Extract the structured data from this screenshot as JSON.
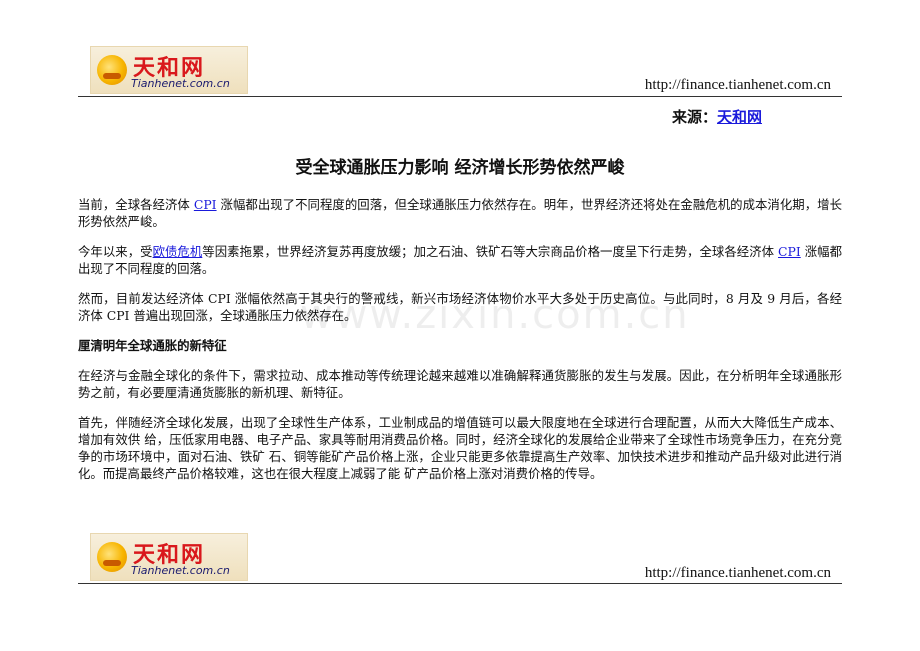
{
  "header": {
    "logo": {
      "cn": "天和网",
      "en": "Tianhenet.com.cn"
    },
    "url": "http://finance.tianhenet.com.cn"
  },
  "source": {
    "label": "来源：",
    "link": "天和网"
  },
  "title": "受全球通胀压力影响 经济增长形势依然严峻",
  "paragraphs": {
    "p1": {
      "a": "当前，全球各经济体 ",
      "cpi": "CPI",
      "b": " 涨幅都出现了不同程度的回落，但全球通胀压力依然存在。明年，世界经济还将处在金融危机的成本消化期，增长形势依然严峻。"
    },
    "p2": {
      "a": "今年以来，受",
      "link": "欧债危机",
      "b": "等因素拖累，世界经济复苏再度放缓；加之石油、铁矿石等大宗商品价格一度呈下行走势，全球各经济体 ",
      "cpi": "CPI",
      "c": " 涨幅都出现了不同程度的回落。"
    },
    "p3": "然而，目前发达经济体 CPI 涨幅依然高于其央行的警戒线，新兴市场经济体物价水平大多处于历史高位。与此同时，8 月及 9 月后，各经济体 CPI 普遍出现回涨，全球通胀压力依然存在。",
    "heading": "厘清明年全球通胀的新特征",
    "p4": "在经济与金融全球化的条件下，需求拉动、成本推动等传统理论越来越难以准确解释通货膨胀的发生与发展。因此，在分析明年全球通胀形势之前，有必要厘清通货膨胀的新机理、新特征。",
    "p5": "首先，伴随经济全球化发展，出现了全球性生产体系，工业制成品的增值链可以最大限度地在全球进行合理配置，从而大大降低生产成本、增加有效供 给，压低家用电器、电子产品、家具等耐用消费品价格。同时，经济全球化的发展给企业带来了全球性市场竞争压力，在充分竞争的市场环境中，面对石油、铁矿 石、铜等能矿产品价格上涨，企业只能更多依靠提高生产效率、加快技术进步和推动产品升级对此进行消化。而提高最终产品价格较难，这也在很大程度上减弱了能 矿产品价格上涨对消费价格的传导。"
  },
  "watermark": "www.zixin.com.cn",
  "footer": {
    "logo": {
      "cn": "天和网",
      "en": "Tianhenet.com.cn"
    },
    "url": "http://finance.tianhenet.com.cn"
  }
}
